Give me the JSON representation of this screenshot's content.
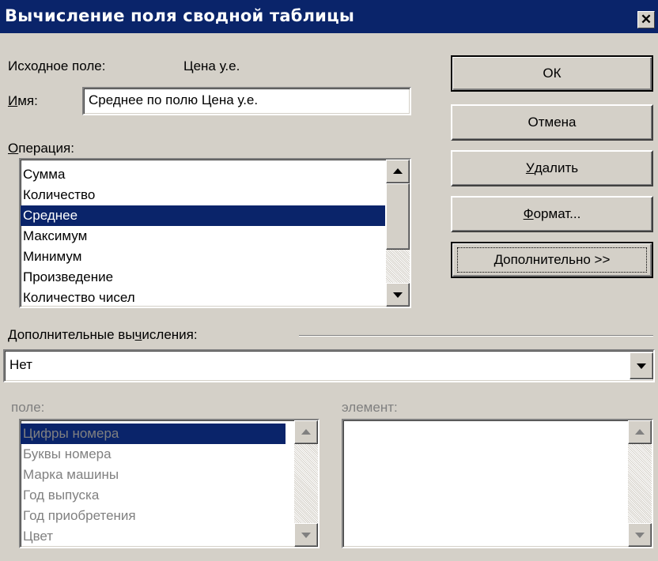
{
  "window": {
    "title": "Вычисление поля сводной таблицы",
    "close_glyph": "✕"
  },
  "source_field": {
    "label": "Исходное поле:",
    "value": "Цена у.е."
  },
  "name": {
    "label_ul": "И",
    "label_rest": "мя:",
    "value": "Среднее по полю Цена у.е."
  },
  "operation": {
    "label_ul": "О",
    "label_rest": "перация:",
    "items": [
      "Сумма",
      "Количество",
      "Среднее",
      "Максимум",
      "Минимум",
      "Произведение",
      "Количество чисел"
    ],
    "selected": "Среднее"
  },
  "buttons": {
    "ok": "ОК",
    "cancel": "Отмена",
    "delete_ul": "У",
    "delete_rest": "далить",
    "format_ul": "Ф",
    "format_rest": "ормат...",
    "more_ul": "Д",
    "more_rest": "ополнительно >>"
  },
  "additional": {
    "label_pre": "Дополнительные вы",
    "label_ul": "ч",
    "label_post": "исления:",
    "value": "Нет"
  },
  "field_list": {
    "label": "поле:",
    "items": [
      "Цифры номера",
      "Буквы номера",
      "Марка машины",
      "Год выпуска",
      "Год приобретения",
      "Цвет"
    ],
    "selected": "Цифры номера"
  },
  "element_list": {
    "label": "элемент:",
    "items": []
  },
  "colors": {
    "title_bar": "#0a246a",
    "selection": "#0a246a",
    "face": "#d4d0c8",
    "disabled_text": "#808080"
  }
}
